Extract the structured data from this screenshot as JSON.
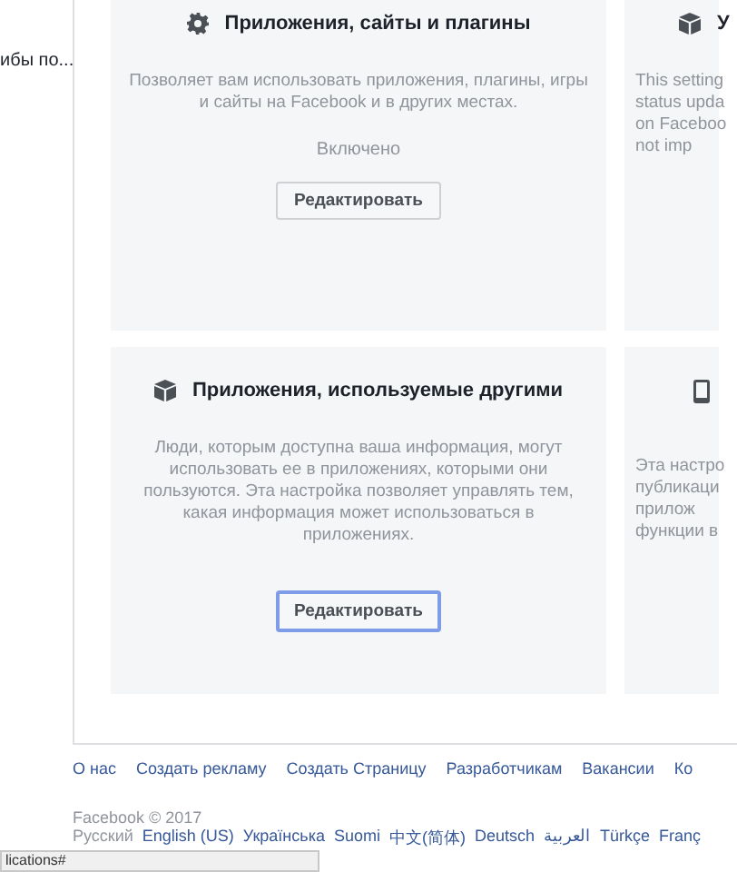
{
  "sidebar": {
    "items": [
      {
        "label": "ибы по..."
      }
    ]
  },
  "cards": [
    {
      "kind": "gear",
      "title": "Приложения, сайты и плагины",
      "lines": [
        "Позволяет вам использовать приложения, плагины, игры",
        "и сайты на Facebook и в других местах."
      ],
      "status": "Включено",
      "button": "Редактировать",
      "focused": false
    },
    {
      "kind": "cube",
      "title": "У",
      "lines": [
        "This setting",
        "status upda",
        "on Faceboo",
        "not imp"
      ]
    },
    {
      "kind": "cube",
      "title": "Приложения, используемые другими",
      "lines": [
        "Люди, которым доступна ваша информация, могут",
        "использовать ее в приложениях, которыми они",
        "пользуются. Эта настройка позволяет управлять тем,",
        "какая информация может использоваться в",
        "приложениях."
      ],
      "button": "Редактировать",
      "focused": true
    },
    {
      "kind": "phone",
      "lines": [
        "Эта настро",
        "публикаци",
        "прилож",
        "функции в"
      ]
    }
  ],
  "footer": {
    "links": [
      "О нас",
      "Создать рекламу",
      "Создать Страницу",
      "Разработчикам",
      "Вакансии",
      "Ко"
    ],
    "copyright": "Facebook © 2017",
    "languages": [
      {
        "label": "Русский",
        "selected": true
      },
      {
        "label": "English (US)",
        "selected": false
      },
      {
        "label": "Українська",
        "selected": false
      },
      {
        "label": "Suomi",
        "selected": false
      },
      {
        "label": "中文(简体)",
        "selected": false
      },
      {
        "label": "Deutsch",
        "selected": false
      },
      {
        "label": "العربية",
        "selected": false
      },
      {
        "label": "Türkçe",
        "selected": false
      },
      {
        "label": "Franç",
        "selected": false
      }
    ]
  },
  "status_bar": {
    "text": "lications#"
  }
}
